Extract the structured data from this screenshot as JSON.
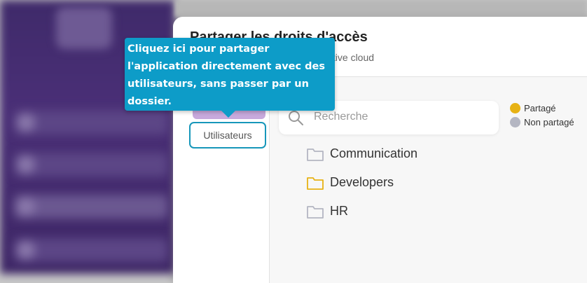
{
  "dialog": {
    "title": "Partager les droits d'accès",
    "subtitle": "Gérer les accès pour adobe creative cloud"
  },
  "tabs": {
    "users_label": "Utilisateurs"
  },
  "search": {
    "placeholder": "Recherche"
  },
  "legend": {
    "shared_label": "Partagé",
    "shared_color": "#e7b214",
    "not_shared_label": "Non partagé",
    "not_shared_color": "#b4b6c2"
  },
  "folders": [
    {
      "name": "Communication",
      "shared": false
    },
    {
      "name": "Developers",
      "shared": true
    },
    {
      "name": "HR",
      "shared": false
    }
  ],
  "tooltip": {
    "text": "Cliquez ici pour partager l'application directement avec des utilisateurs, sans passer par un dossier."
  }
}
